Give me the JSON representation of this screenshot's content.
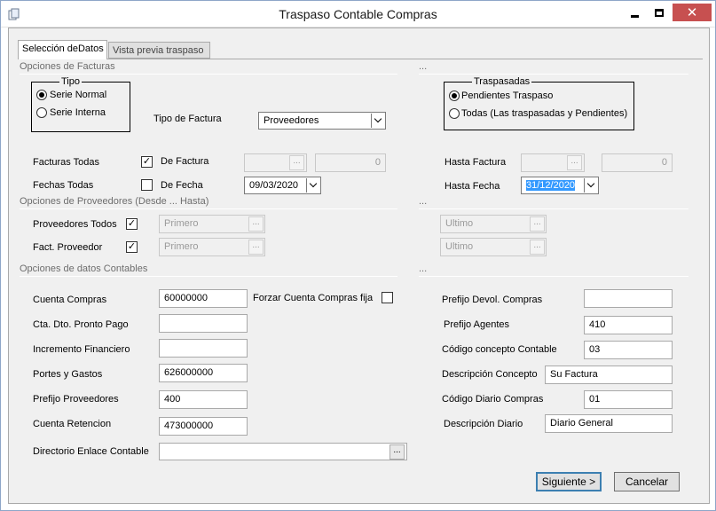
{
  "window": {
    "title": "Traspaso Contable Compras"
  },
  "tabs": [
    {
      "label": "Selección deDatos"
    },
    {
      "label": "Vista previa traspaso"
    }
  ],
  "sections": {
    "facturas": "Opciones de Facturas",
    "facturas_right": "...",
    "proveedores": "Opciones de Proveedores (Desde ... Hasta)",
    "proveedores_right": "...",
    "contables": "Opciones de datos Contables",
    "contables_right": "..."
  },
  "tipo": {
    "legend": "Tipo",
    "serie_normal": "Serie Normal",
    "serie_interna": "Serie Interna",
    "tipo_factura_label": "Tipo de Factura",
    "tipo_factura_value": "Proveedores"
  },
  "traspasadas": {
    "legend": "Traspasadas",
    "pendientes": "Pendientes Traspaso",
    "todas": "Todas (Las traspasadas y Pendientes)"
  },
  "facturas": {
    "facturas_todas_label": "Facturas Todas",
    "de_factura_label": "De Factura",
    "de_factura_number": "0",
    "hasta_factura_label": "Hasta Factura",
    "hasta_factura_number": "0",
    "fechas_todas_label": "Fechas Todas",
    "de_fecha_label": "De Fecha",
    "de_fecha_value": "09/03/2020",
    "hasta_fecha_label": "Hasta Fecha",
    "hasta_fecha_value": "31/12/2020"
  },
  "proveedores": {
    "todos_label": "Proveedores Todos",
    "todos_from": "Primero",
    "todos_to": "Ultimo",
    "fact_label": "Fact. Proveedor",
    "fact_from": "Primero",
    "fact_to": "Ultimo"
  },
  "contables": {
    "cuenta_compras_label": "Cuenta Compras",
    "cuenta_compras_value": "60000000",
    "forzar_label": "Forzar Cuenta Compras fija",
    "cta_dto_label": "Cta. Dto. Pronto Pago",
    "cta_dto_value": "",
    "incremento_label": "Incremento Financiero",
    "incremento_value": "",
    "portes_label": "Portes y Gastos",
    "portes_value": "626000000",
    "prefijo_prov_label": "Prefijo Proveedores",
    "prefijo_prov_value": "400",
    "cuenta_ret_label": "Cuenta Retencion",
    "cuenta_ret_value": "473000000",
    "directorio_label": "Directorio Enlace Contable",
    "directorio_value": "",
    "prefijo_devol_label": "Prefijo Devol. Compras",
    "prefijo_devol_value": "",
    "prefijo_agentes_label": "Prefijo Agentes",
    "prefijo_agentes_value": "410",
    "codigo_concepto_label": "Código concepto Contable",
    "codigo_concepto_value": "03",
    "desc_concepto_label": "Descripción Concepto",
    "desc_concepto_value": "Su Factura",
    "codigo_diario_label": "Código Diario Compras",
    "codigo_diario_value": "01",
    "desc_diario_label": "Descripción Diario",
    "desc_diario_value": "Diario General"
  },
  "buttons": {
    "siguiente": "Siguiente >",
    "cancelar": "Cancelar",
    "ellipsis": "..."
  }
}
